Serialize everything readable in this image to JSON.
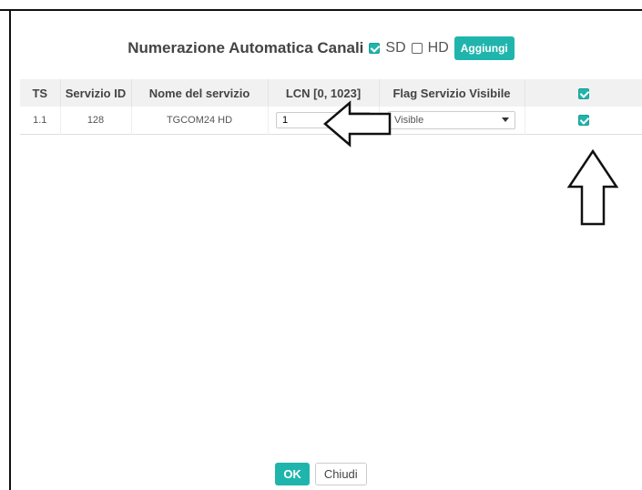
{
  "header": {
    "title": "Numerazione Automatica Canali",
    "sd_label": "SD",
    "sd_checked": true,
    "hd_label": "HD",
    "hd_checked": false,
    "add_button": "Aggiungi"
  },
  "table": {
    "columns": [
      "TS",
      "Servizio ID",
      "Nome del servizio",
      "LCN  [0, 1023]",
      "Flag Servizio Visibile"
    ],
    "header_checkbox_checked": true,
    "rows": [
      {
        "ts": "1.1",
        "service_id": "128",
        "service_name": "TGCOM24 HD",
        "lcn": "1",
        "visibility": "Visible",
        "checked": true
      }
    ]
  },
  "footer": {
    "ok_label": "OK",
    "close_label": "Chiudi"
  },
  "colors": {
    "accent": "#1fb5ad"
  }
}
